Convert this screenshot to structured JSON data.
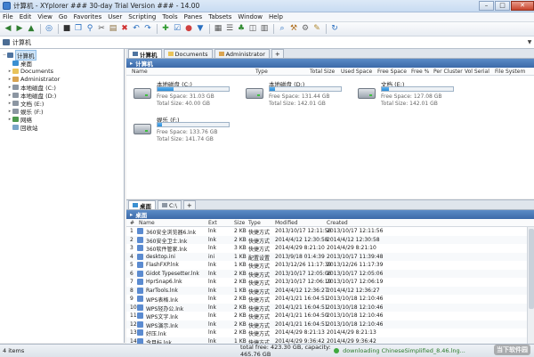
{
  "window": {
    "title": "计算机 - XYplorer ### 30-day Trial Version ### - 14.00",
    "minimize": "–",
    "maximize": "□",
    "close": "✕"
  },
  "menu": [
    "File",
    "Edit",
    "View",
    "Go",
    "Favorites",
    "User",
    "Scripting",
    "Tools",
    "Panes",
    "Tabsets",
    "Window",
    "Help"
  ],
  "toolbar_icons": [
    "back-icon",
    "forward-icon",
    "up-icon",
    "browse-icon",
    "terminal-icon",
    "copy-icon",
    "find-icon",
    "scissors-icon",
    "paste-icon",
    "delete-icon",
    "undo-icon",
    "redo-icon",
    "new-icon",
    "checklist-icon",
    "color-icon",
    "filter-icon",
    "grid-icon",
    "list-icon",
    "tree-icon",
    "panes-icon",
    "details-icon",
    "zoom-icon",
    "tools-icon",
    "settings-icon",
    "broom-icon",
    "refresh-icon"
  ],
  "address": {
    "text": "计算机",
    "dropdown": "▼"
  },
  "tree": {
    "items": [
      {
        "label": "计算机",
        "icon": "computer-icon",
        "level": 0,
        "selected": true
      },
      {
        "label": "桌面",
        "icon": "desktop-icon",
        "level": 1
      },
      {
        "label": "Documents",
        "icon": "folder-icon",
        "level": 1
      },
      {
        "label": "Administrator",
        "icon": "user-folder-icon",
        "level": 1
      },
      {
        "label": "本地磁盘 (C:)",
        "icon": "drive-icon",
        "level": 1
      },
      {
        "label": "本地磁盘 (D:)",
        "icon": "drive-icon",
        "level": 1
      },
      {
        "label": "文档 (E:)",
        "icon": "drive-icon",
        "level": 1
      },
      {
        "label": "娱乐 (F:)",
        "icon": "drive-icon",
        "level": 1
      },
      {
        "label": "网络",
        "icon": "network-icon",
        "level": 1
      },
      {
        "label": "回收站",
        "icon": "recycle-bin-icon",
        "level": 1
      }
    ]
  },
  "pane1": {
    "tabs": [
      {
        "label": "计算机",
        "active": true
      },
      {
        "label": "Documents",
        "active": false
      },
      {
        "label": "Administrator",
        "active": false
      }
    ],
    "add_tab": "+",
    "location": "计算机",
    "columns": [
      "Name",
      "Type",
      "Total Size",
      "Used Space",
      "Free Space",
      "Free %",
      "Per Cluster",
      "Vol Serial",
      "File System"
    ],
    "drives": [
      {
        "name": "本地磁盘 (C:)",
        "free": "Free Space: 31.03 GB",
        "total": "Total Size: 40.00 GB",
        "used_fraction": 0.22
      },
      {
        "name": "本地磁盘 (D:)",
        "free": "Free Space: 131.44 GB",
        "total": "Total Size: 142.01 GB",
        "used_fraction": 0.07
      },
      {
        "name": "文档 (E:)",
        "free": "Free Space: 127.08 GB",
        "total": "Total Size: 142.01 GB",
        "used_fraction": 0.1
      },
      {
        "name": "娱乐 (F:)",
        "free": "Free Space: 133.76 GB",
        "total": "Total Size: 141.74 GB",
        "used_fraction": 0.06
      }
    ]
  },
  "pane2": {
    "tabs": [
      {
        "label": "桌面",
        "active": true
      },
      {
        "label": "C:\\",
        "active": false
      }
    ],
    "add_tab": "+",
    "location": "桌面",
    "columns": [
      "#",
      "Name",
      "Ext",
      "Size",
      "Type",
      "Modified",
      "Created"
    ],
    "files": [
      {
        "n": "1",
        "name": "360安全浏览器6.lnk",
        "ext": "lnk",
        "size": "2 KB",
        "type": "快捷方式",
        "modified": "2013/10/17 12:11:56",
        "created": "2013/10/17 12:11:56"
      },
      {
        "n": "2",
        "name": "360安全卫士.lnk",
        "ext": "lnk",
        "size": "2 KB",
        "type": "快捷方式",
        "modified": "2014/4/12 12:30:58",
        "created": "2014/4/12 12:30:58"
      },
      {
        "n": "3",
        "name": "360软件管家.lnk",
        "ext": "lnk",
        "size": "3 KB",
        "type": "快捷方式",
        "modified": "2014/4/29 8:21:10",
        "created": "2014/4/29 8:21:10"
      },
      {
        "n": "4",
        "name": "desktop.ini",
        "ext": "ini",
        "size": "1 KB",
        "type": "配置设置",
        "modified": "2013/9/18 01:4:39",
        "created": "2013/10/17 11:39:48"
      },
      {
        "n": "5",
        "name": "FlashFXP.lnk",
        "ext": "lnk",
        "size": "1 KB",
        "type": "快捷方式",
        "modified": "2013/12/26 11:17:39",
        "created": "2013/12/26 11:17:39"
      },
      {
        "n": "6",
        "name": "Gidot Typesetter.lnk",
        "ext": "lnk",
        "size": "2 KB",
        "type": "快捷方式",
        "modified": "2013/10/17 12:05:06",
        "created": "2013/10/17 12:05:06"
      },
      {
        "n": "7",
        "name": "HprSnap6.lnk",
        "ext": "lnk",
        "size": "2 KB",
        "type": "快捷方式",
        "modified": "2013/10/17 12:06:19",
        "created": "2013/10/17 12:06:19"
      },
      {
        "n": "8",
        "name": "RarTools.lnk",
        "ext": "lnk",
        "size": "1 KB",
        "type": "快捷方式",
        "modified": "2014/4/12 12:36:27",
        "created": "2014/4/12 12:36:27"
      },
      {
        "n": "9",
        "name": "WPS表格.lnk",
        "ext": "lnk",
        "size": "2 KB",
        "type": "快捷方式",
        "modified": "2014/1/21 16:04:51",
        "created": "2013/10/18 12:10:46"
      },
      {
        "n": "10",
        "name": "WPS轻办公.lnk",
        "ext": "lnk",
        "size": "2 KB",
        "type": "快捷方式",
        "modified": "2014/1/21 16:04:51",
        "created": "2013/10/18 12:10:46"
      },
      {
        "n": "11",
        "name": "WPS文字.lnk",
        "ext": "lnk",
        "size": "2 KB",
        "type": "快捷方式",
        "modified": "2014/1/21 16:04:50",
        "created": "2013/10/18 12:10:46"
      },
      {
        "n": "12",
        "name": "WPS演示.lnk",
        "ext": "lnk",
        "size": "2 KB",
        "type": "快捷方式",
        "modified": "2014/1/21 16:04:51",
        "created": "2013/10/18 12:10:46"
      },
      {
        "n": "13",
        "name": "好压.lnk",
        "ext": "lnk",
        "size": "2 KB",
        "type": "快捷方式",
        "modified": "2014/4/29 8:21:13",
        "created": "2014/4/29 8:21:13"
      },
      {
        "n": "14",
        "name": "今目标.lnk",
        "ext": "lnk",
        "size": "1 KB",
        "type": "快捷方式",
        "modified": "2014/4/29 9:36:42",
        "created": "2014/4/29 9:36:42"
      }
    ]
  },
  "status": {
    "items": "4 items",
    "total": "total free: 423.30 GB, capacity: 465.76 GB",
    "download": "downloading ChineseSimplified_8.46.lng..."
  },
  "watermark": "当下软件园"
}
